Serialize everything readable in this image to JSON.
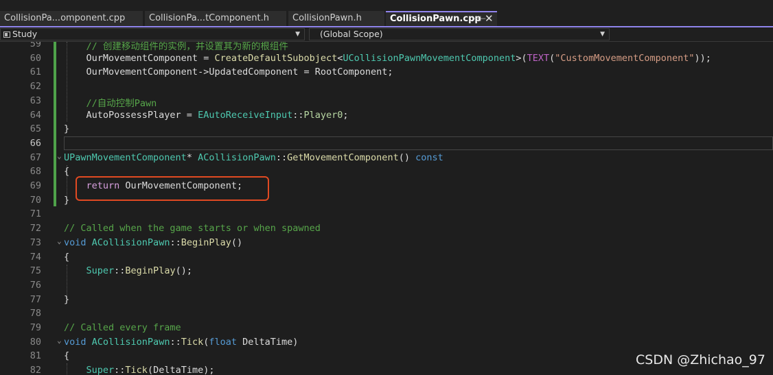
{
  "tabs": [
    {
      "label": "CollisionPa...omponent.cpp",
      "active": false
    },
    {
      "label": "CollisionPa...tComponent.h",
      "active": false
    },
    {
      "label": "CollisionPawn.h",
      "active": false
    },
    {
      "label": "CollisionPawn.cpp",
      "active": true
    }
  ],
  "tab_icons": {
    "pin": "pin-icon",
    "close": "close-icon"
  },
  "navbar": {
    "project": "Study",
    "scope": "(Global Scope)"
  },
  "editor": {
    "current_line": 66,
    "lines": [
      {
        "n": "59",
        "text": "    // 创建移动组件的实例，并设置其为新的根组件"
      },
      {
        "n": "60",
        "text": "    OurMovementComponent = CreateDefaultSubobject<UCollisionPawnMovementComponent>(TEXT(\"CustomMovementComponent\"));"
      },
      {
        "n": "61",
        "text": "    OurMovementComponent->UpdatedComponent = RootComponent;"
      },
      {
        "n": "62",
        "text": ""
      },
      {
        "n": "63",
        "text": "    //自动控制Pawn"
      },
      {
        "n": "64",
        "text": "    AutoPossessPlayer = EAutoReceiveInput::Player0;"
      },
      {
        "n": "65",
        "text": "}"
      },
      {
        "n": "66",
        "text": ""
      },
      {
        "n": "67",
        "text": "UPawnMovementComponent* ACollisionPawn::GetMovementComponent() const"
      },
      {
        "n": "68",
        "text": "{"
      },
      {
        "n": "69",
        "text": "    return OurMovementComponent;"
      },
      {
        "n": "70",
        "text": "}"
      },
      {
        "n": "71",
        "text": ""
      },
      {
        "n": "72",
        "text": "// Called when the game starts or when spawned"
      },
      {
        "n": "73",
        "text": "void ACollisionPawn::BeginPlay()"
      },
      {
        "n": "74",
        "text": "{"
      },
      {
        "n": "75",
        "text": "    Super::BeginPlay();"
      },
      {
        "n": "76",
        "text": ""
      },
      {
        "n": "77",
        "text": "}"
      },
      {
        "n": "78",
        "text": ""
      },
      {
        "n": "79",
        "text": "// Called every frame"
      },
      {
        "n": "80",
        "text": "void ACollisionPawn::Tick(float DeltaTime)"
      },
      {
        "n": "81",
        "text": "{"
      },
      {
        "n": "82",
        "text": "    Super::Tick(DeltaTime);"
      }
    ]
  },
  "colors": {
    "background": "#1e1e1e",
    "active_tab_accent": "#9184ee",
    "change_bar": "#4fa24a",
    "highlight_box": "#e24a22"
  },
  "watermark": "CSDN @Zhichao_97"
}
